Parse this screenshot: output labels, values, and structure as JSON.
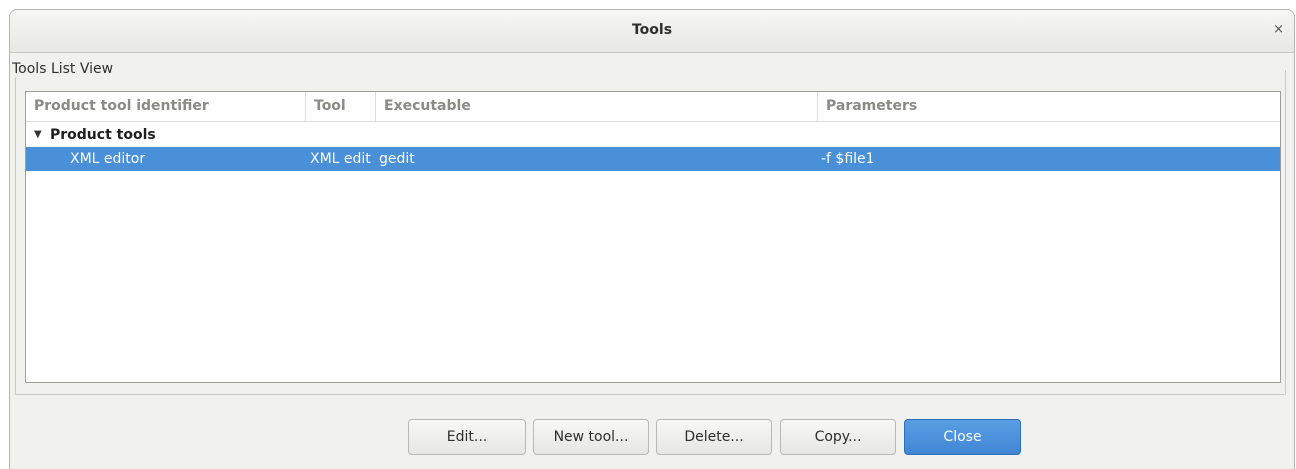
{
  "window": {
    "title": "Tools",
    "close_glyph": "×"
  },
  "group": {
    "label": "Tools List View"
  },
  "columns": [
    {
      "label": "Product tool identifier"
    },
    {
      "label": "Tool"
    },
    {
      "label": "Executable"
    },
    {
      "label": "Parameters"
    }
  ],
  "tree": {
    "group_expander_glyph": "▼",
    "group_label": "Product tools",
    "rows": [
      {
        "identifier": "XML editor",
        "tool": "XML edit",
        "executable": "gedit",
        "parameters": "-f $file1",
        "selected": true
      }
    ]
  },
  "buttons": {
    "edit": "Edit...",
    "new_tool": "New tool...",
    "delete": "Delete...",
    "copy": "Copy...",
    "close": "Close"
  },
  "colors": {
    "selection": "#4a90d9",
    "primary_button": "#3f86d4"
  }
}
